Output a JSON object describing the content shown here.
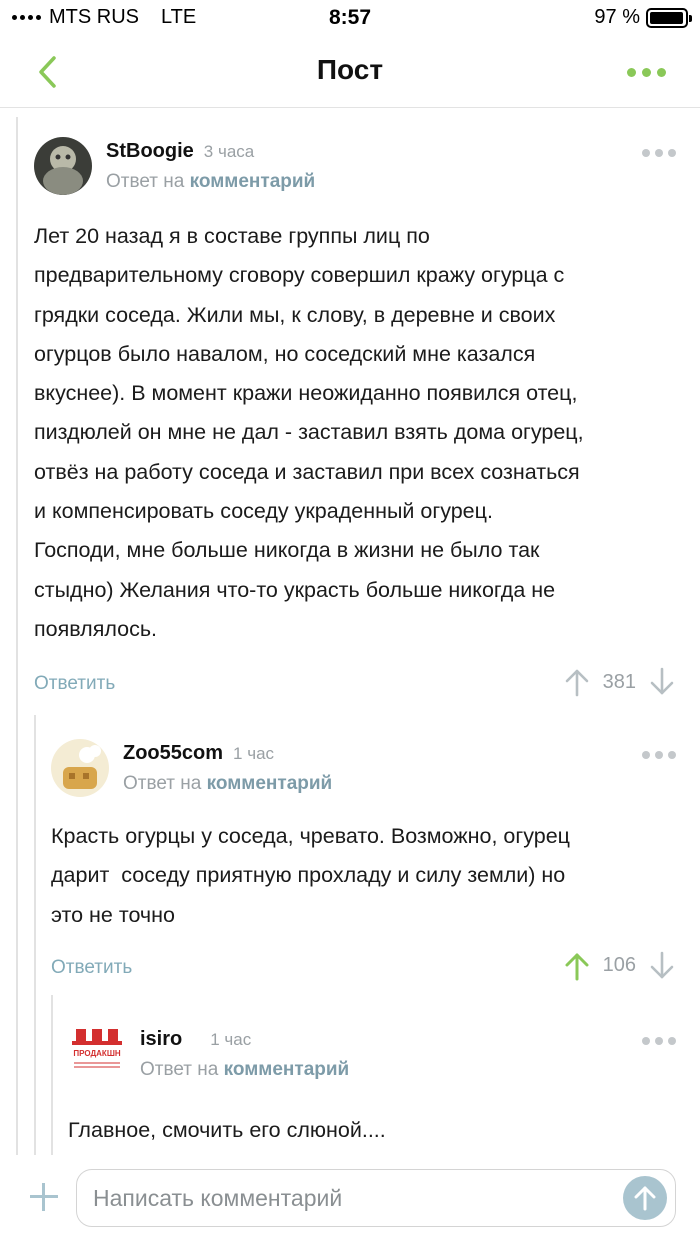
{
  "status_bar": {
    "carrier": "MTS RUS",
    "network": "LTE",
    "time": "8:57",
    "battery_label": "97 %",
    "battery_level": 0.97
  },
  "nav": {
    "title": "Пост"
  },
  "colors": {
    "accent_green": "#8ac858",
    "link_blue_gray": "#7d9ba8",
    "muted": "#9aa0a4"
  },
  "comments": [
    {
      "username": "StBoogie",
      "time": "3 часа",
      "reply_prefix": "Ответ на",
      "reply_link": "комментарий",
      "lines": [
        "Лет 20 назад я в составе группы лиц по",
        "предварительному сговору совершил кражу огурца с",
        "грядки соседа. Жили мы, к слову, в деревне и своих",
        "огурцов было навалом, но соседский мне казался",
        "вкуснее). В момент кражи неожиданно появился отец,",
        "пиздюлей он мне не дал - заставил взять дома огурец,",
        "отвёз на работу соседа и заставил при всех сознаться",
        "и компенсировать соседу украденный огурец.",
        "Господи, мне больше никогда в жизни не было так",
        "стыдно) Желания что-то украсть больше никогда не",
        "появлялось."
      ],
      "reply_label": "Ответить",
      "rating": "381",
      "upvoted": false
    },
    {
      "username": "Zoo55com",
      "time": "1 час",
      "reply_prefix": "Ответ на",
      "reply_link": "комментарий",
      "lines": [
        "Красть огурцы у соседа, чревато. Возможно, огурец",
        "дарит  соседу приятную прохладу и силу земли) но",
        "это не точно"
      ],
      "reply_label": "Ответить",
      "rating": "106",
      "upvoted": true
    },
    {
      "username": "isiro",
      "time": "1 час",
      "reply_prefix": "Ответ на",
      "reply_link": "комментарий",
      "lines": [
        "Главное, смочить его слюной...."
      ],
      "avatar_logo_text": "ПРОДАКШН"
    }
  ],
  "input": {
    "placeholder": "Написать комментарий"
  }
}
